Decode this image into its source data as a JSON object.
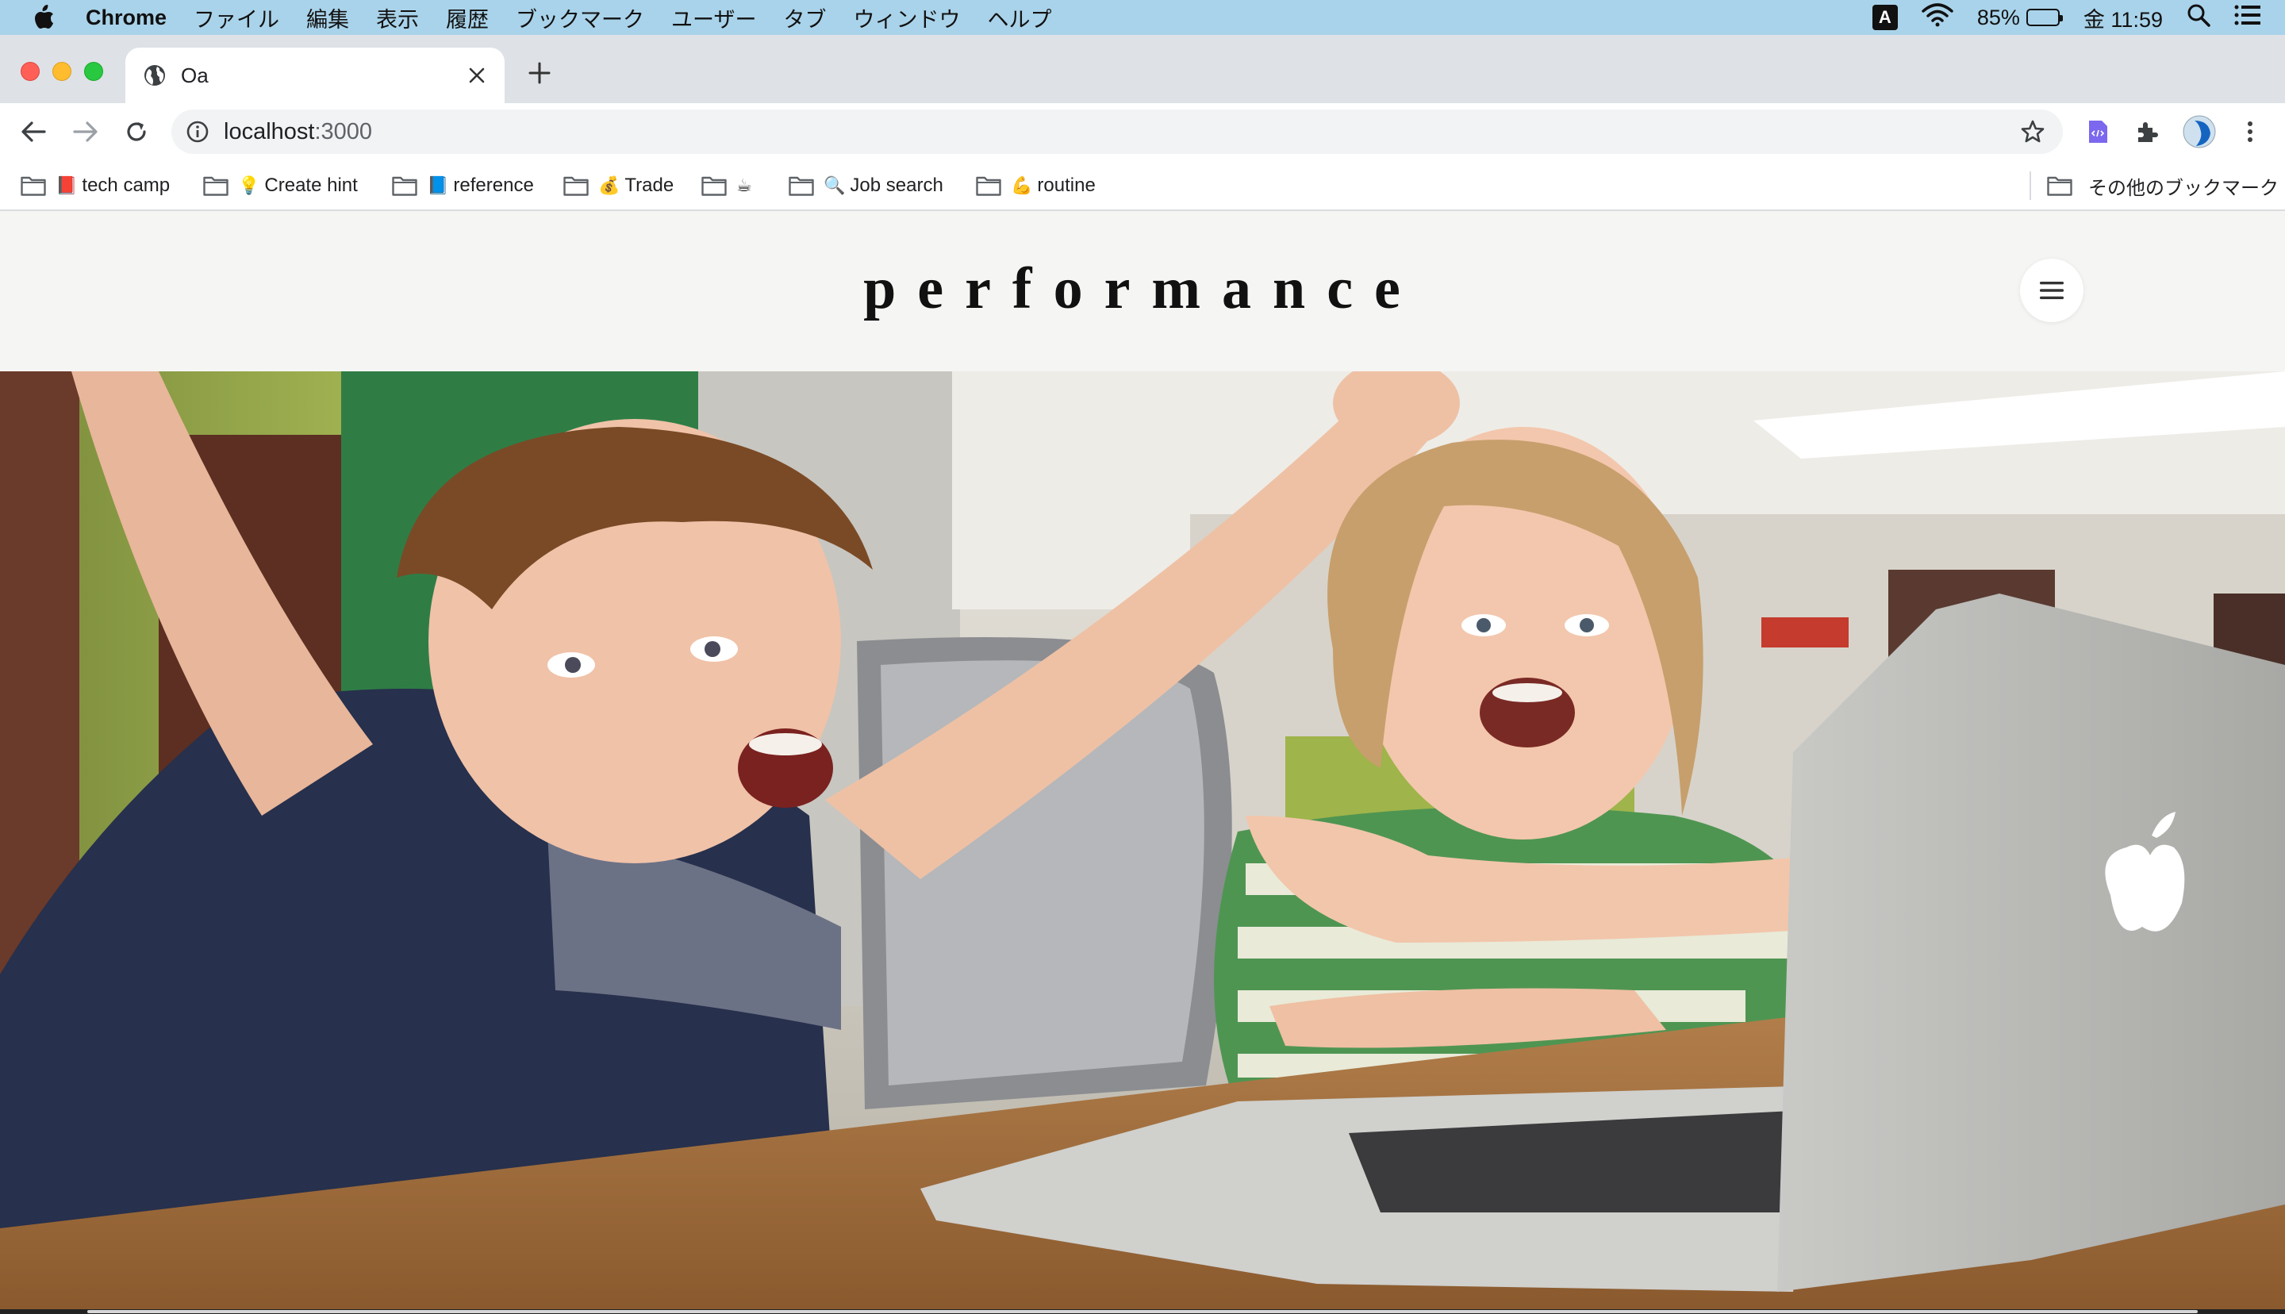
{
  "menubar": {
    "app_name": "Chrome",
    "items": [
      "ファイル",
      "編集",
      "表示",
      "履歴",
      "ブックマーク",
      "ユーザー",
      "タブ",
      "ウィンドウ",
      "ヘルプ"
    ],
    "ime": "A",
    "battery_percent": "85%",
    "battery_level": 0.85,
    "clock": "金 11:59"
  },
  "browser": {
    "tab_title": "Oa",
    "url_host": "localhost",
    "url_port": ":3000"
  },
  "bookmarks": {
    "items": [
      {
        "emoji": "📕",
        "label": "tech camp"
      },
      {
        "emoji": "💡",
        "label": "Create hint"
      },
      {
        "emoji": "📘",
        "label": "reference"
      },
      {
        "emoji": "💰",
        "label": "Trade"
      },
      {
        "emoji": "☕",
        "label": ""
      },
      {
        "emoji": "🔍",
        "label": "Job search"
      },
      {
        "emoji": "💪",
        "label": "routine"
      }
    ],
    "other": "その他のブックマーク"
  },
  "site": {
    "logo": "performance"
  }
}
